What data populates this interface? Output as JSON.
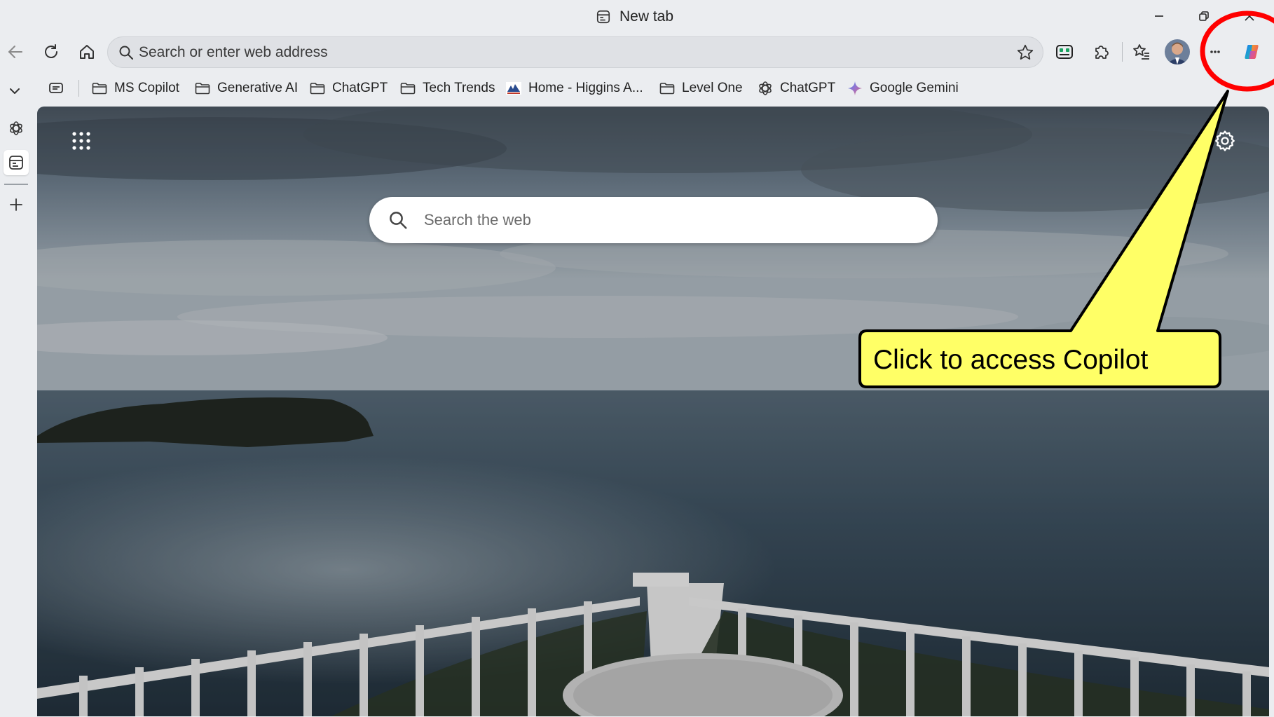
{
  "window": {
    "title": "New tab",
    "controls": {
      "minimize": "minimize-icon",
      "restore": "restore-icon",
      "close": "close-icon"
    }
  },
  "toolbar": {
    "address_placeholder": "Search or enter web address",
    "icons": [
      "back-icon",
      "refresh-icon",
      "home-icon",
      "favorite-star-icon",
      "extension-app-icon",
      "extensions-puzzle-icon",
      "favorites-icon",
      "profile-avatar",
      "more-options-icon",
      "copilot-icon"
    ]
  },
  "bookmarks": {
    "items": [
      {
        "label": "MS Copilot",
        "icon": "folder-icon"
      },
      {
        "label": "Generative AI",
        "icon": "folder-icon"
      },
      {
        "label": "ChatGPT",
        "icon": "folder-icon"
      },
      {
        "label": "Tech Trends",
        "icon": "folder-icon"
      },
      {
        "label": "Home - Higgins A...",
        "icon": "site-favicon-icon"
      },
      {
        "label": "Level One",
        "icon": "folder-icon"
      },
      {
        "label": "ChatGPT",
        "icon": "openai-icon"
      },
      {
        "label": "Google Gemini",
        "icon": "gemini-icon"
      }
    ]
  },
  "sidebar": {
    "icons": [
      "collapse-chevron-icon",
      "openai-icon",
      "new-tab-page-icon",
      "add-tab-icon"
    ]
  },
  "ntp": {
    "search_placeholder": "Search the web",
    "background": "ocean view from a white balcony with an island on the left"
  },
  "annotation": {
    "callout_text": "Click to access Copilot",
    "callout_color": "#ffff66",
    "circle_color": "#ff0000"
  }
}
